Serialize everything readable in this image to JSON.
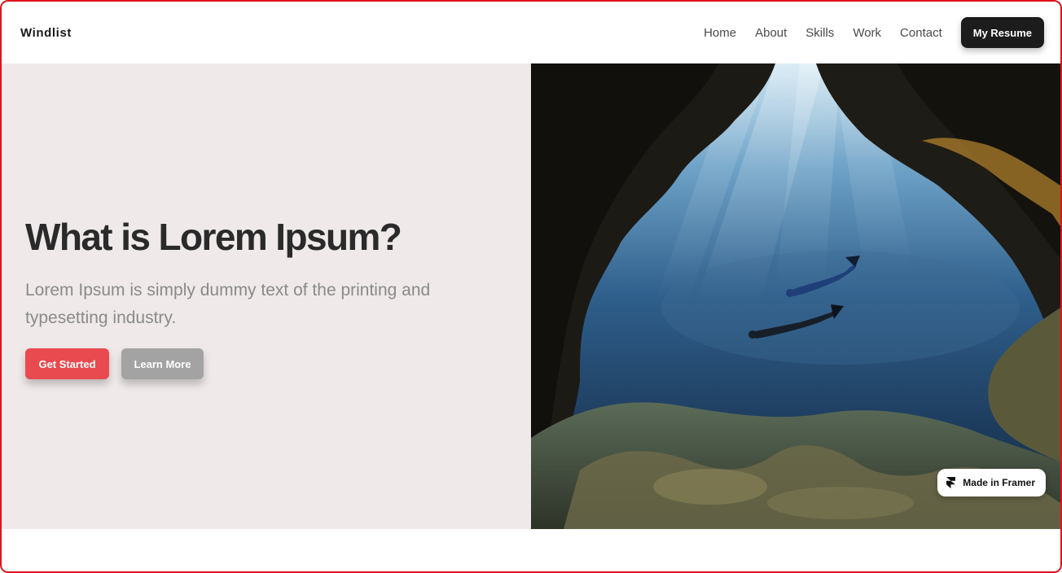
{
  "brand": {
    "name": "Windlist"
  },
  "nav": {
    "links": [
      "Home",
      "About",
      "Skills",
      "Work",
      "Contact"
    ],
    "cta": "My Resume"
  },
  "hero": {
    "title": "What is Lorem Ipsum?",
    "subtitle": "Lorem Ipsum is simply dummy text of the printing and typesetting industry.",
    "primary_button": "Get Started",
    "secondary_button": "Learn More",
    "image": "underwater-cave-freedivers"
  },
  "badge": {
    "label": "Made in Framer",
    "icon": "framer-icon"
  },
  "colors": {
    "frame_border": "#e0131a",
    "hero_bg": "#efe9e9",
    "primary": "#e94a4f",
    "secondary": "#a3a3a3",
    "dark_button": "#1c1c1c"
  }
}
